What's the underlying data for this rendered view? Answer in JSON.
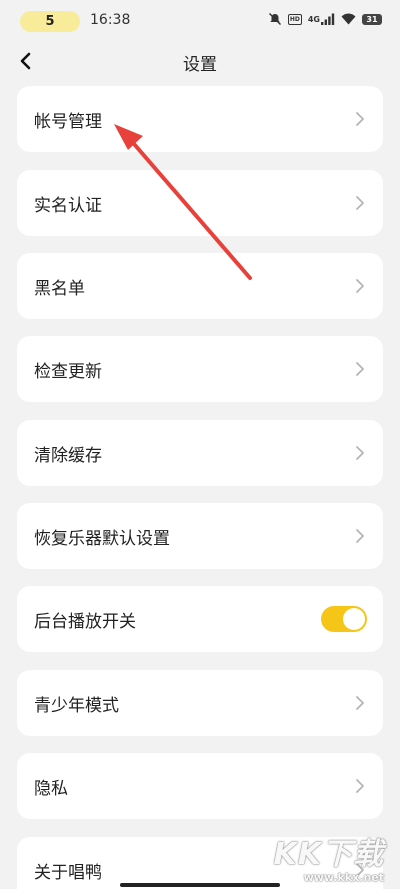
{
  "status_bar": {
    "badge": "5",
    "time": "16:38",
    "network": "4G",
    "hd": "HD",
    "battery": "31"
  },
  "header": {
    "title": "设置"
  },
  "settings": {
    "items": [
      {
        "label": "帐号管理",
        "control": "chevron"
      },
      {
        "label": "实名认证",
        "control": "chevron"
      },
      {
        "label": "黑名单",
        "control": "chevron"
      },
      {
        "label": "检查更新",
        "control": "chevron"
      },
      {
        "label": "清除缓存",
        "control": "chevron"
      },
      {
        "label": "恢复乐器默认设置",
        "control": "chevron"
      },
      {
        "label": "后台播放开关",
        "control": "toggle",
        "toggle_on": true
      },
      {
        "label": "青少年模式",
        "control": "chevron"
      },
      {
        "label": "隐私",
        "control": "chevron"
      },
      {
        "label": "关于唱鸭",
        "control": "chevron"
      }
    ]
  },
  "colors": {
    "background": "#f2f2f2",
    "card": "#ffffff",
    "accent": "#f5c518",
    "badge": "#f8ec9a",
    "annotation_arrow": "#e8403a"
  },
  "watermark": {
    "brand": "KK下载",
    "url": "www.kkx.net"
  }
}
